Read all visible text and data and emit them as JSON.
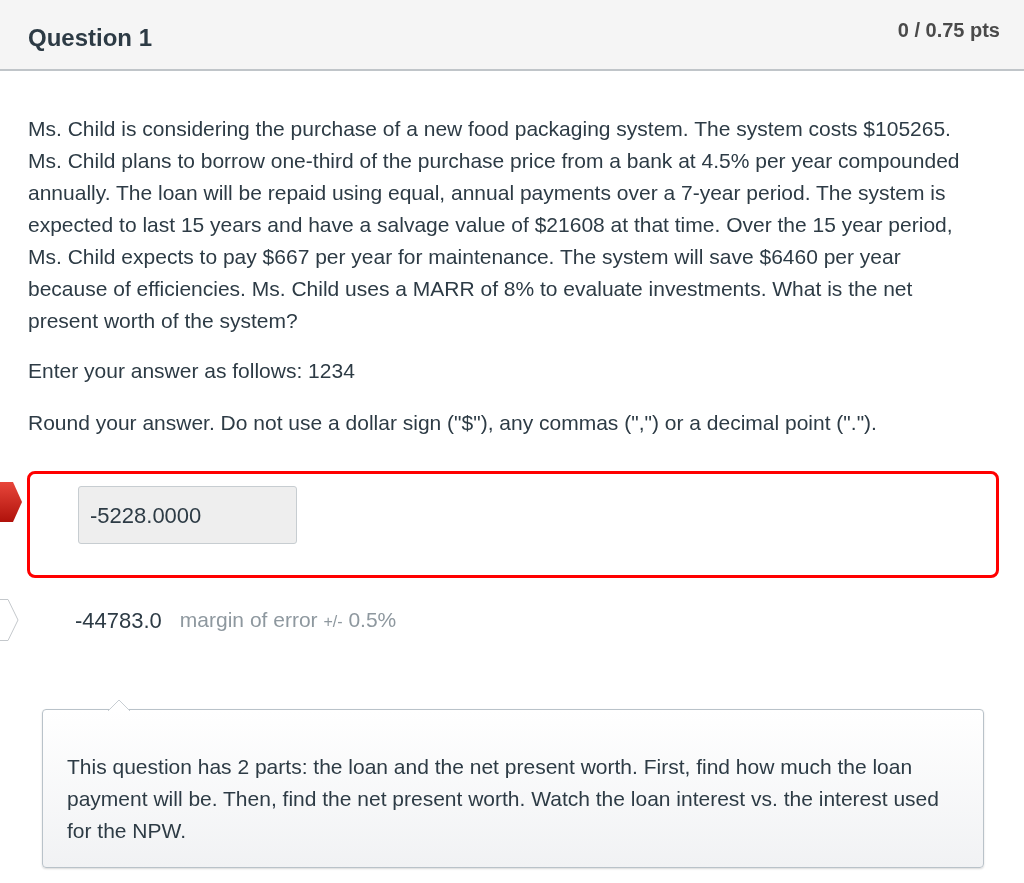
{
  "header": {
    "title": "Question 1",
    "points": "0 / 0.75 pts"
  },
  "question": {
    "paragraphs": [
      "Ms. Child is considering the purchase of a new food packaging system. The system costs $105265. Ms. Child plans to borrow one-third of the purchase price from a bank at 4.5% per year compounded annually. The loan will be repaid using equal, annual payments over a 7-year period. The system is expected to last 15 years and have a salvage value of $21608 at that time. Over the 15 year period, Ms. Child expects to pay $667 per year for maintenance. The system will save $6460 per year because of efficiencies. Ms. Child uses a MARR of 8% to evaluate investments. What is the net present worth of the system?",
      "Enter your answer as follows: 1234",
      "Round your answer. Do not use a dollar sign (\"$\"), any commas (\",\") or a decimal point (\".\")."
    ]
  },
  "user_answer": {
    "value": "-5228.0000",
    "correct": false
  },
  "correct_answer": {
    "value": "-44783.0",
    "margin_label": "margin of error",
    "tolerance_sign": "+/-",
    "tolerance": "0.5%"
  },
  "comment": {
    "text": "This question has 2 parts: the loan and the net present worth. First, find how much the loan payment will be. Then, find the net present worth. Watch the loan interest vs. the interest used for the NPW."
  }
}
